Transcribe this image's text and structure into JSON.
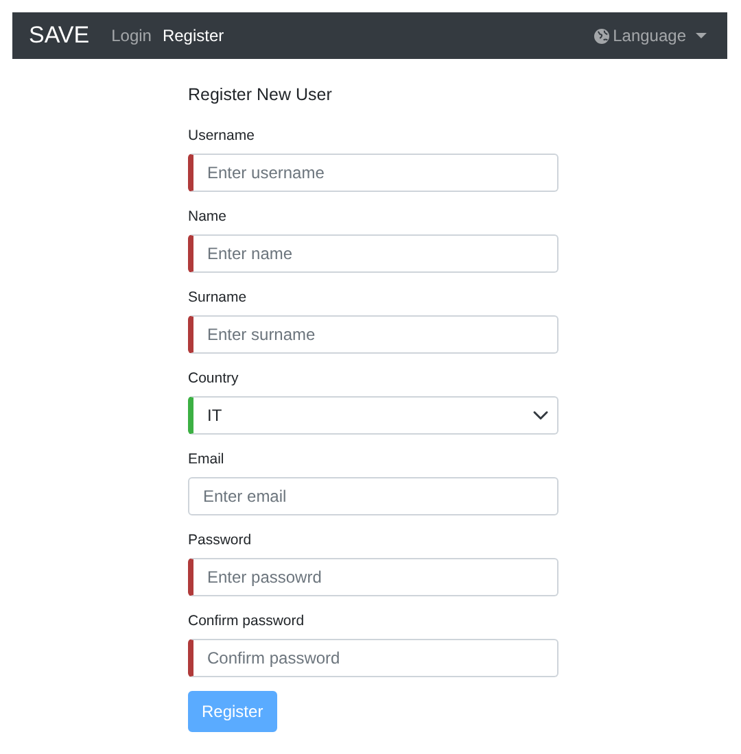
{
  "navbar": {
    "brand": "SAVE",
    "links": [
      {
        "label": "Login",
        "selected": false
      },
      {
        "label": "Register",
        "selected": true
      }
    ],
    "language": {
      "label": "Language"
    }
  },
  "form": {
    "title": "Register New User",
    "fields": [
      {
        "kind": "input",
        "label": "Username",
        "placeholder": "Enter username",
        "invalid": true,
        "valid": false
      },
      {
        "kind": "input",
        "label": "Name",
        "placeholder": "Enter name",
        "invalid": true,
        "valid": false
      },
      {
        "kind": "input",
        "label": "Surname",
        "placeholder": "Enter surname",
        "invalid": true,
        "valid": false
      },
      {
        "kind": "select",
        "label": "Country",
        "value": "IT",
        "invalid": false,
        "valid": true
      },
      {
        "kind": "input",
        "label": "Email",
        "placeholder": "Enter email",
        "invalid": false,
        "valid": false
      },
      {
        "kind": "input",
        "label": "Password",
        "placeholder": "Enter passowrd",
        "invalid": true,
        "valid": false
      },
      {
        "kind": "input",
        "label": "Confirm password",
        "placeholder": "Confirm password",
        "invalid": true,
        "valid": false
      }
    ],
    "submit": {
      "label": "Register",
      "disabled": true
    }
  }
}
